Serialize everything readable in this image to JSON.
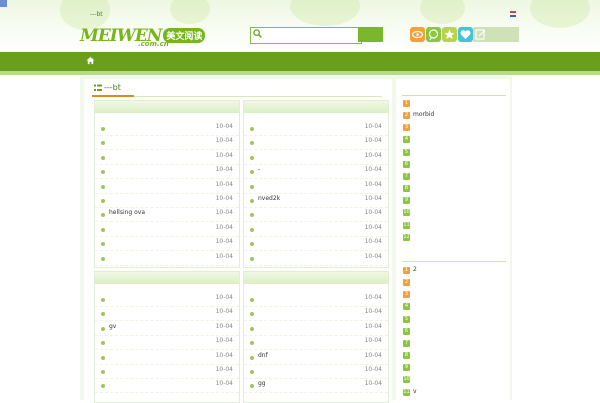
{
  "header": {
    "top_link": "---bt",
    "logo": {
      "english": "MEIWEN",
      "chinese": "美文阅读",
      "domain": ".com.cn"
    },
    "search": {
      "placeholder": ""
    },
    "tool_icons": [
      {
        "name": "eye-icon",
        "color": "#f2a13a"
      },
      {
        "name": "leaf-icon",
        "color": "#8cc63e"
      },
      {
        "name": "star-icon",
        "color": "#b8d54a"
      },
      {
        "name": "heart-icon",
        "color": "#48c2d8"
      }
    ],
    "colors": {
      "brand": "#76b51b",
      "nav": "#6a9f1c",
      "accent": "#e18a23"
    }
  },
  "main": {
    "title": "---bt",
    "boxes": [
      {
        "rows": [
          {
            "title": "",
            "date": "10-04"
          },
          {
            "title": "",
            "date": "10-04"
          },
          {
            "title": "",
            "date": "10-04"
          },
          {
            "title": "",
            "date": "10-04"
          },
          {
            "title": "",
            "date": "10-04"
          },
          {
            "title": "",
            "date": "10-04"
          },
          {
            "title": "hellsing ova",
            "date": "10-04"
          },
          {
            "title": "",
            "date": "10-04"
          },
          {
            "title": "",
            "date": "10-04"
          },
          {
            "title": "",
            "date": "10-04"
          }
        ]
      },
      {
        "rows": [
          {
            "title": "",
            "date": "10-04"
          },
          {
            "title": "",
            "date": "10-04"
          },
          {
            "title": "",
            "date": "10-04"
          },
          {
            "title": "-",
            "date": "10-04"
          },
          {
            "title": "",
            "date": "10-04"
          },
          {
            "title": "nved2k",
            "date": "10-04"
          },
          {
            "title": "",
            "date": "10-04"
          },
          {
            "title": "",
            "date": "10-04"
          },
          {
            "title": "",
            "date": "10-04"
          },
          {
            "title": "",
            "date": "10-04"
          }
        ]
      },
      {
        "rows": [
          {
            "title": "",
            "date": "10-04"
          },
          {
            "title": "",
            "date": "10-04"
          },
          {
            "title": "gv",
            "date": "10-04"
          },
          {
            "title": "",
            "date": "10-04"
          },
          {
            "title": "",
            "date": "10-04"
          },
          {
            "title": "",
            "date": "10-04"
          },
          {
            "title": "",
            "date": "10-04"
          }
        ]
      },
      {
        "rows": [
          {
            "title": "",
            "date": "10-04"
          },
          {
            "title": "",
            "date": "10-04"
          },
          {
            "title": "",
            "date": "10-04"
          },
          {
            "title": "",
            "date": "10-04"
          },
          {
            "title": "dnf",
            "date": "10-04"
          },
          {
            "title": "",
            "date": "10-04"
          },
          {
            "title": "gg",
            "date": "10-04"
          }
        ]
      }
    ]
  },
  "sidebar": {
    "sections": [
      {
        "items": [
          {
            "num": "1",
            "title": ""
          },
          {
            "num": "2",
            "title": "morbid"
          },
          {
            "num": "3",
            "title": ""
          },
          {
            "num": "4",
            "title": ""
          },
          {
            "num": "5",
            "title": ""
          },
          {
            "num": "6",
            "title": ""
          },
          {
            "num": "7",
            "title": ""
          },
          {
            "num": "8",
            "title": ""
          },
          {
            "num": "9",
            "title": ""
          },
          {
            "num": "10",
            "title": ""
          },
          {
            "num": "11",
            "title": ""
          },
          {
            "num": "12",
            "title": ""
          }
        ]
      },
      {
        "items": [
          {
            "num": "1",
            "title": "2"
          },
          {
            "num": "2",
            "title": ""
          },
          {
            "num": "3",
            "title": ""
          },
          {
            "num": "4",
            "title": ""
          },
          {
            "num": "5",
            "title": ""
          },
          {
            "num": "6",
            "title": ""
          },
          {
            "num": "7",
            "title": ""
          },
          {
            "num": "8",
            "title": ""
          },
          {
            "num": "9",
            "title": ""
          },
          {
            "num": "10",
            "title": ""
          },
          {
            "num": "11",
            "title": "v"
          }
        ]
      }
    ],
    "rank_colors": {
      "top": "#f2a13a",
      "rest": "#8cc63e"
    }
  }
}
